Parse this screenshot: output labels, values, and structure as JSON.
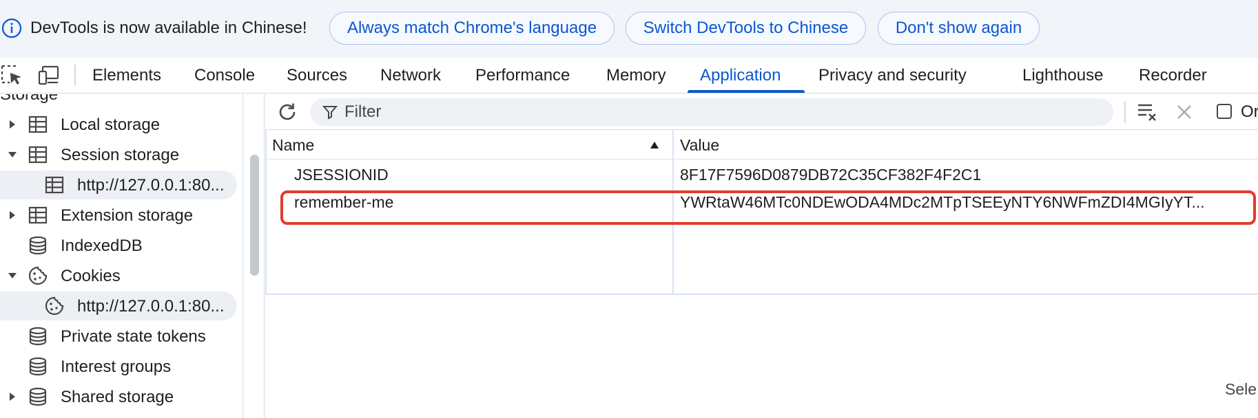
{
  "infobar": {
    "message": "DevTools is now available in Chinese!",
    "buttons": [
      "Always match Chrome's language",
      "Switch DevTools to Chinese",
      "Don't show again"
    ]
  },
  "tabs": [
    "Elements",
    "Console",
    "Sources",
    "Network",
    "Performance",
    "Memory",
    "Application",
    "Privacy and security",
    "Lighthouse",
    "Recorder"
  ],
  "active_tab": "Application",
  "sidebar": {
    "heading": "Storage",
    "items": [
      {
        "label": "Local storage",
        "icon": "table-icon",
        "caret": "right"
      },
      {
        "label": "Session storage",
        "icon": "table-icon",
        "caret": "down"
      },
      {
        "label": "http://127.0.0.1:80...",
        "icon": "table-icon",
        "caret": "none",
        "child": true,
        "selected": false
      },
      {
        "label": "Extension storage",
        "icon": "table-icon",
        "caret": "right"
      },
      {
        "label": "IndexedDB",
        "icon": "database-icon",
        "caret": "none"
      },
      {
        "label": "Cookies",
        "icon": "cookie-icon",
        "caret": "down"
      },
      {
        "label": "http://127.0.0.1:80...",
        "icon": "cookie-icon",
        "caret": "none",
        "child": true,
        "selected": true
      },
      {
        "label": "Private state tokens",
        "icon": "database-icon",
        "caret": "none"
      },
      {
        "label": "Interest groups",
        "icon": "database-icon",
        "caret": "none"
      },
      {
        "label": "Shared storage",
        "icon": "database-icon",
        "caret": "right"
      }
    ]
  },
  "toolbar": {
    "filter_placeholder": "Filter",
    "only_label": "Or"
  },
  "table": {
    "columns": [
      "Name",
      "Value"
    ],
    "rows": [
      {
        "name": "JSESSIONID",
        "value": "8F17F7596D0879DB72C35CF382F4F2C1"
      },
      {
        "name": "remember-me",
        "value": "YWRtaW46MTc0NDEwODA4MDc2MTpTSEEyNTY6NWFmZDI4MGIyYT..."
      }
    ]
  },
  "status": {
    "text": "Sele"
  },
  "colors": {
    "accent": "#0b57d0",
    "highlight": "#e53a2b",
    "infobar_bg": "#f1f4f9"
  }
}
